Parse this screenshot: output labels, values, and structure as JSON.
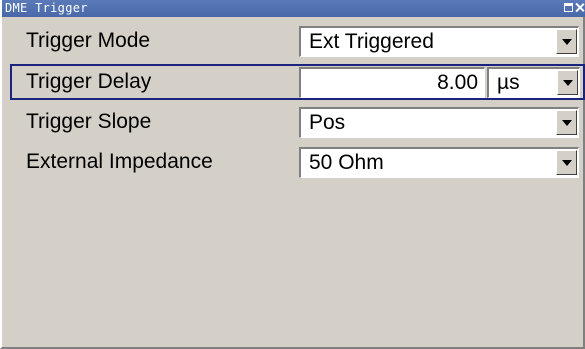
{
  "window": {
    "title": "DME Trigger",
    "colors": {
      "panel": "#d4d0c8",
      "titlebar": "#4a68a8",
      "highlight_border": "#1a237e"
    }
  },
  "fields": {
    "trigger_mode": {
      "label": "Trigger Mode",
      "value": "Ext Triggered"
    },
    "trigger_delay": {
      "label": "Trigger Delay",
      "value": "8.00",
      "unit": "µs"
    },
    "trigger_slope": {
      "label": "Trigger Slope",
      "value": "Pos"
    },
    "external_impedance": {
      "label": "External Impedance",
      "value": "50 Ohm"
    }
  },
  "icons": {
    "maximize": "maximize-icon",
    "close": "close-icon",
    "dropdown": "chevron-down-icon"
  }
}
